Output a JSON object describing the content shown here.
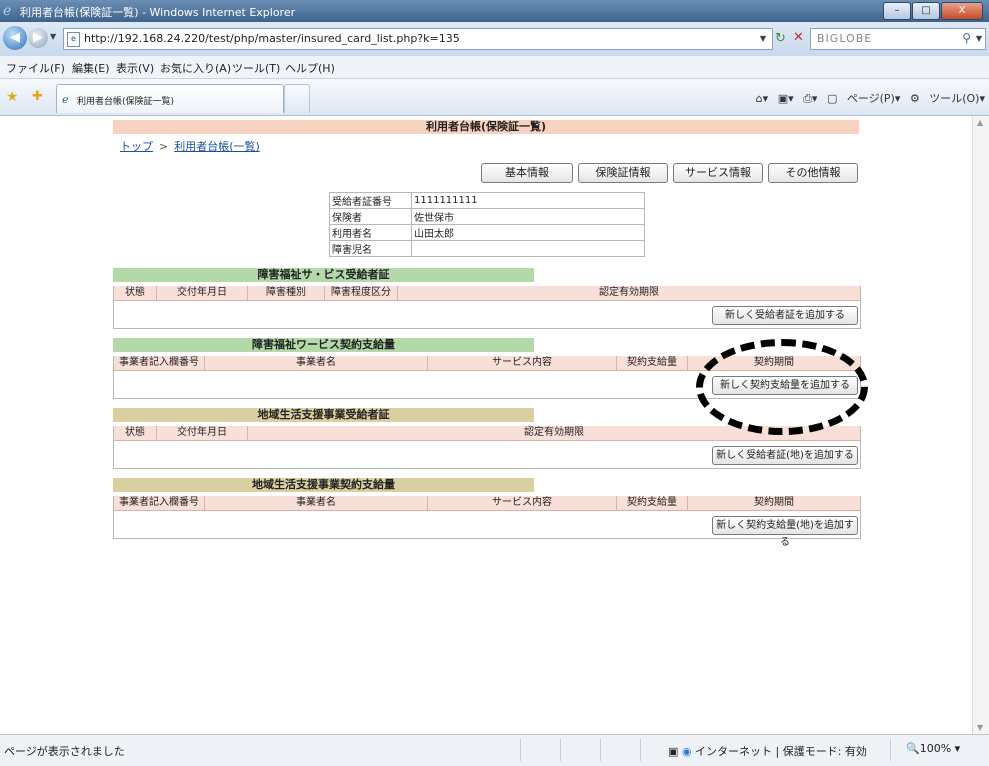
{
  "window": {
    "title": "利用者台帳(保険証一覧) - Windows Internet Explorer",
    "controls": [
      "–",
      "□",
      "X"
    ]
  },
  "address": {
    "url": "http://192.168.24.220/test/php/master/insured_card_list.php?k=135",
    "search_value": "BIGLOBE"
  },
  "menu": [
    "ファイル(F)",
    "編集(E)",
    "表示(V)",
    "お気に入り(A)",
    "ツール(T)",
    "ヘルプ(H)"
  ],
  "tab": {
    "label": "利用者台帳(保険証一覧)"
  },
  "commands": {
    "page": "ページ(P)",
    "tools": "ツール(O)"
  },
  "page": {
    "title": "利用者台帳(保険証一覧)",
    "breadcrumb": {
      "top": "トップ",
      "sep": ">",
      "current": "利用者台帳(一覧)"
    },
    "tabs": [
      "基本情報",
      "保険証情報",
      "サービス情報",
      "その他情報"
    ],
    "info": [
      {
        "key": "受給者証番号",
        "value": "1111111111"
      },
      {
        "key": "保険者",
        "value": "佐世保市"
      },
      {
        "key": "利用者名",
        "value": "山田太郎"
      },
      {
        "key": "障害児名",
        "value": ""
      }
    ],
    "sections": [
      {
        "title": "障害福祉サ・ビス受給者証",
        "color": "#b3d9a8",
        "columns": [
          "状態",
          "交付年月日",
          "障害種別",
          "障害程度区分",
          "認定有効期限"
        ],
        "add_button": "新しく受給者証を追加する"
      },
      {
        "title": "障害福祉ワービス契約支給量",
        "color": "#b3d9a8",
        "columns": [
          "事業者記入欄番号",
          "事業者名",
          "サービス内容",
          "契約支給量",
          "契約期間"
        ],
        "add_button": "新しく契約支給量を追加する"
      },
      {
        "title": "地域生活支援事業受給者証",
        "color": "#d9cfa1",
        "columns": [
          "状態",
          "交付年月日",
          "認定有効期限"
        ],
        "add_button": "新しく受給者証(地)を追加する"
      },
      {
        "title": "地域生活支援事業契約支給量",
        "color": "#d9cfa1",
        "columns": [
          "事業者記入欄番号",
          "事業者名",
          "サービス内容",
          "契約支給量",
          "契約期間"
        ],
        "add_button": "新しく契約支給量(地)を追加する"
      }
    ]
  },
  "status": {
    "text": "ページが表示されました",
    "zone": "インターネット | 保護モード: 有効",
    "zoom": "100%"
  }
}
